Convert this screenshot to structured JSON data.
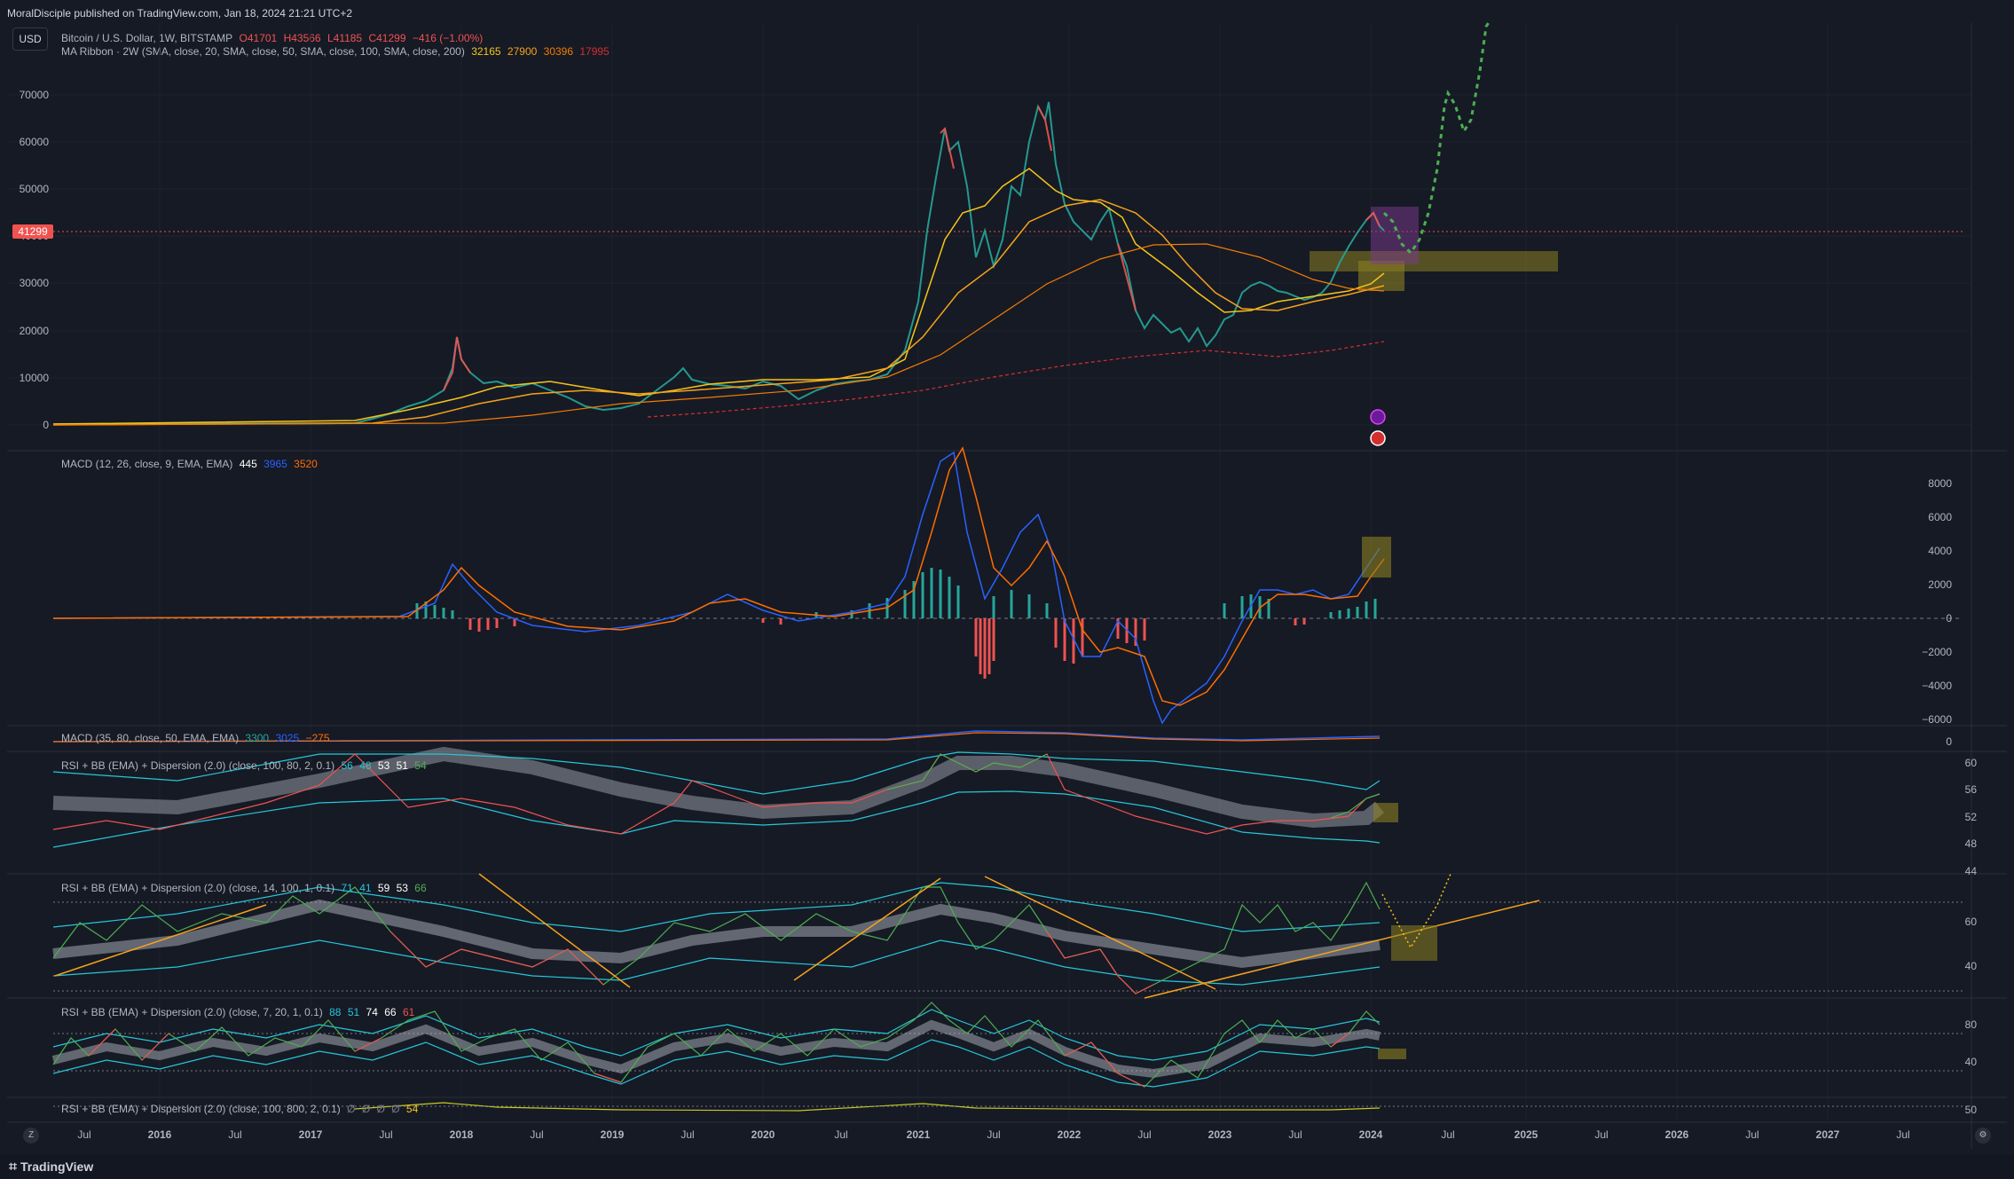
{
  "header": {
    "published": "MoralDisciple published on TradingView.com, Jan 18, 2024 21:21 UTC+2",
    "currency": "USD",
    "symbol": "Bitcoin / U.S. Dollar, 1W, BITSTAMP",
    "ohlc": {
      "o": "O41701",
      "h": "H43566",
      "l": "L41185",
      "c": "C41299",
      "chg": "−416 (−1.00%)"
    },
    "ribbon": "MA Ribbon · 2W (SMA, close, 20, SMA, close, 50, SMA, close, 100, SMA, close, 200)",
    "ribbon_values": [
      "32165",
      "27900",
      "30396",
      "17995"
    ],
    "price_tag": "41299"
  },
  "price_axis": [
    "70000",
    "60000",
    "50000",
    "40000",
    "30000",
    "20000",
    "10000",
    "0"
  ],
  "macd1": {
    "label": "MACD (12, 26, close, 9, EMA, EMA)",
    "values": [
      "445",
      "3965",
      "3520"
    ],
    "axis": [
      "8000",
      "6000",
      "4000",
      "2000",
      "0",
      "−2000",
      "−4000",
      "−6000"
    ]
  },
  "macd2": {
    "label": "MACD (35, 80, close, 50, EMA, EMA)",
    "values": [
      "3300",
      "3025",
      "−275"
    ],
    "axis": [
      "0"
    ]
  },
  "rsi1": {
    "label": "RSI + BB (EMA) + Dispersion (2.0) (close, 100, 80, 2, 0.1)",
    "values": [
      "56",
      "48",
      "53",
      "51",
      "54"
    ],
    "axis": [
      "60",
      "56",
      "52",
      "48",
      "44"
    ]
  },
  "rsi2": {
    "label": "RSI + BB (EMA) + Dispersion (2.0) (close, 14, 100, 1, 0.1)",
    "values": [
      "71",
      "41",
      "59",
      "53",
      "66"
    ],
    "axis": [
      "60",
      "40"
    ]
  },
  "rsi3": {
    "label": "RSI + BB (EMA) + Dispersion (2.0) (close, 7, 20, 1, 0.1)",
    "values": [
      "88",
      "51",
      "74",
      "66",
      "61"
    ],
    "axis": [
      "80",
      "40"
    ]
  },
  "rsi4": {
    "label": "RSI + BB (EMA) + Dispersion (2.0) (close, 100, 800, 2, 0.1)",
    "values": [
      "Ø",
      "Ø",
      "Ø",
      "Ø",
      "54"
    ],
    "axis": [
      "50"
    ]
  },
  "time_axis": [
    "Jul",
    "2016",
    "Jul",
    "2017",
    "Jul",
    "2018",
    "Jul",
    "2019",
    "Jul",
    "2020",
    "Jul",
    "2021",
    "Jul",
    "2022",
    "Jul",
    "2023",
    "Jul",
    "2024",
    "Jul",
    "2025",
    "Jul",
    "2026",
    "Jul",
    "2027",
    "Jul"
  ],
  "footer": {
    "brand": "TradingView"
  },
  "colors": {
    "bg": "#161a25",
    "up": "#26a69a",
    "down": "#ef5350",
    "macd_line": "#2962ff",
    "signal_line": "#ff6d00",
    "ribbon1": "#f5c518",
    "ribbon2": "#f7a21b",
    "ribbon3": "#f57c00",
    "ribbon4": "#d32f2f",
    "projection": "#4caf50",
    "zone": "#8a7f22"
  }
}
